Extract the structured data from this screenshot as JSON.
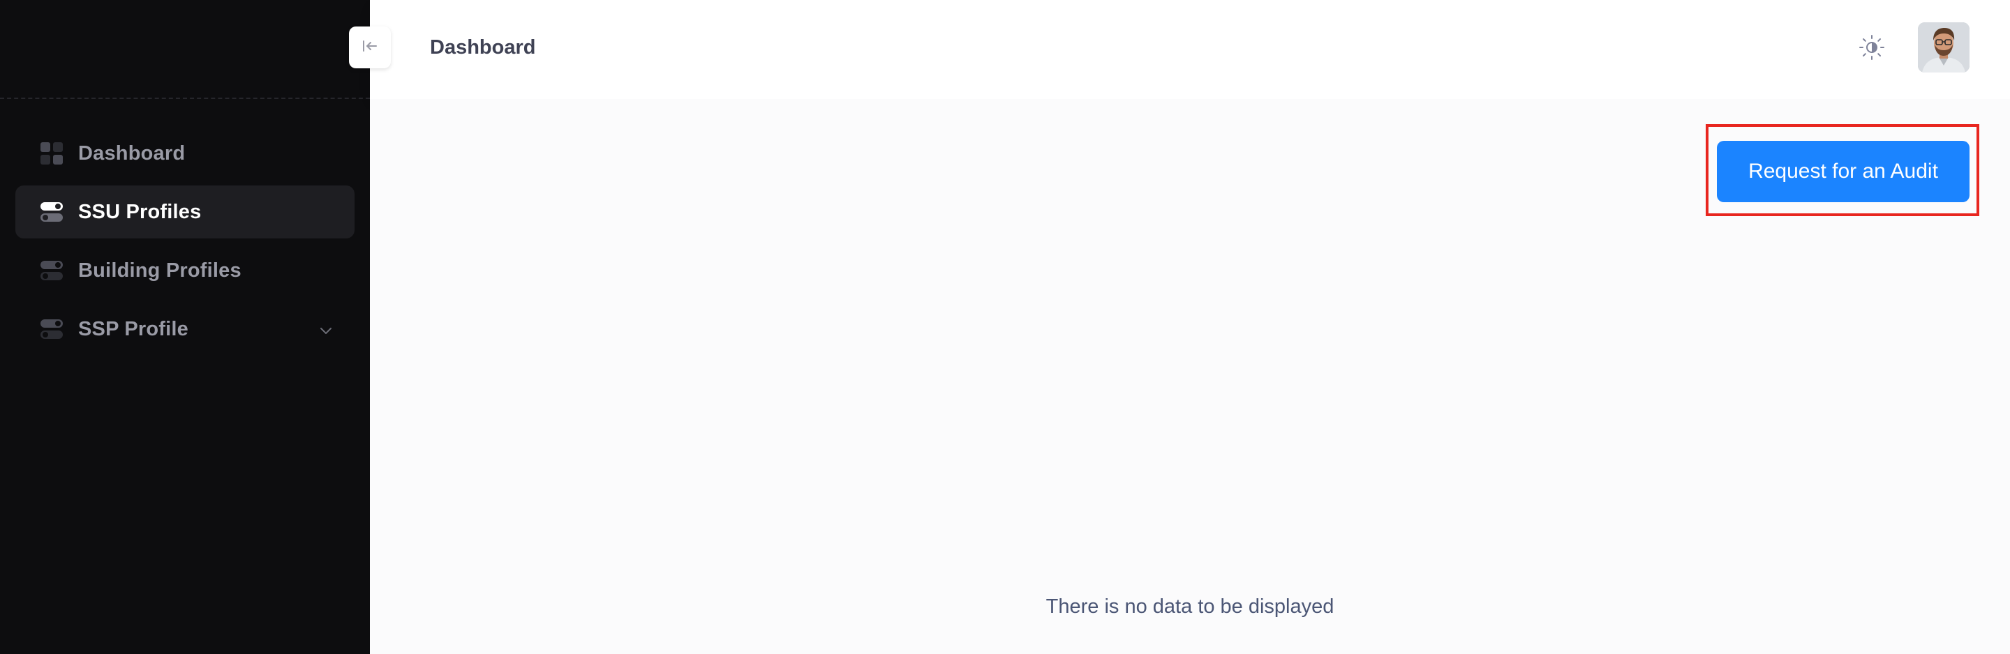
{
  "header": {
    "title": "Dashboard"
  },
  "sidebar": {
    "items": [
      {
        "label": "Dashboard",
        "icon": "dashboard-grid-icon",
        "active": false
      },
      {
        "label": "SSU Profiles",
        "icon": "toggle-icon",
        "active": true
      },
      {
        "label": "Building Profiles",
        "icon": "toggle-icon",
        "active": false
      },
      {
        "label": "SSP Profile",
        "icon": "toggle-icon",
        "active": false,
        "has_submenu": true
      }
    ]
  },
  "main": {
    "audit_button_label": "Request for an Audit",
    "empty_message": "There is no data to be displayed"
  },
  "colors": {
    "sidebar_bg": "#0d0d0f",
    "accent": "#1b84ff",
    "highlight": "#e8261f"
  }
}
